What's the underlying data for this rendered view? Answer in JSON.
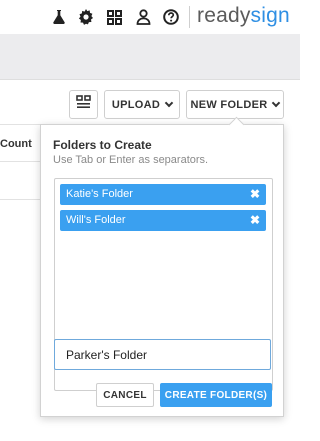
{
  "topbar": {
    "icons": [
      "flask-icon",
      "gear-icon",
      "grid-icon",
      "user-icon",
      "help-icon"
    ],
    "brand_ready": "ready",
    "brand_sign": "sign"
  },
  "toolbar": {
    "upload_label": "UPLOAD",
    "new_folder_label": "NEW FOLDER"
  },
  "table": {
    "column_header": "Count"
  },
  "popover": {
    "title": "Folders to Create",
    "subtitle": "Use Tab or Enter as separators.",
    "tags": [
      {
        "label": "Katie's Folder"
      },
      {
        "label": "Will's Folder"
      }
    ],
    "input_value": "Parker's Folder",
    "cancel_label": "CANCEL",
    "create_label": "CREATE FOLDER(S)"
  },
  "colors": {
    "accent": "#3aa0f0",
    "brand_blue": "#2f8fe3"
  }
}
